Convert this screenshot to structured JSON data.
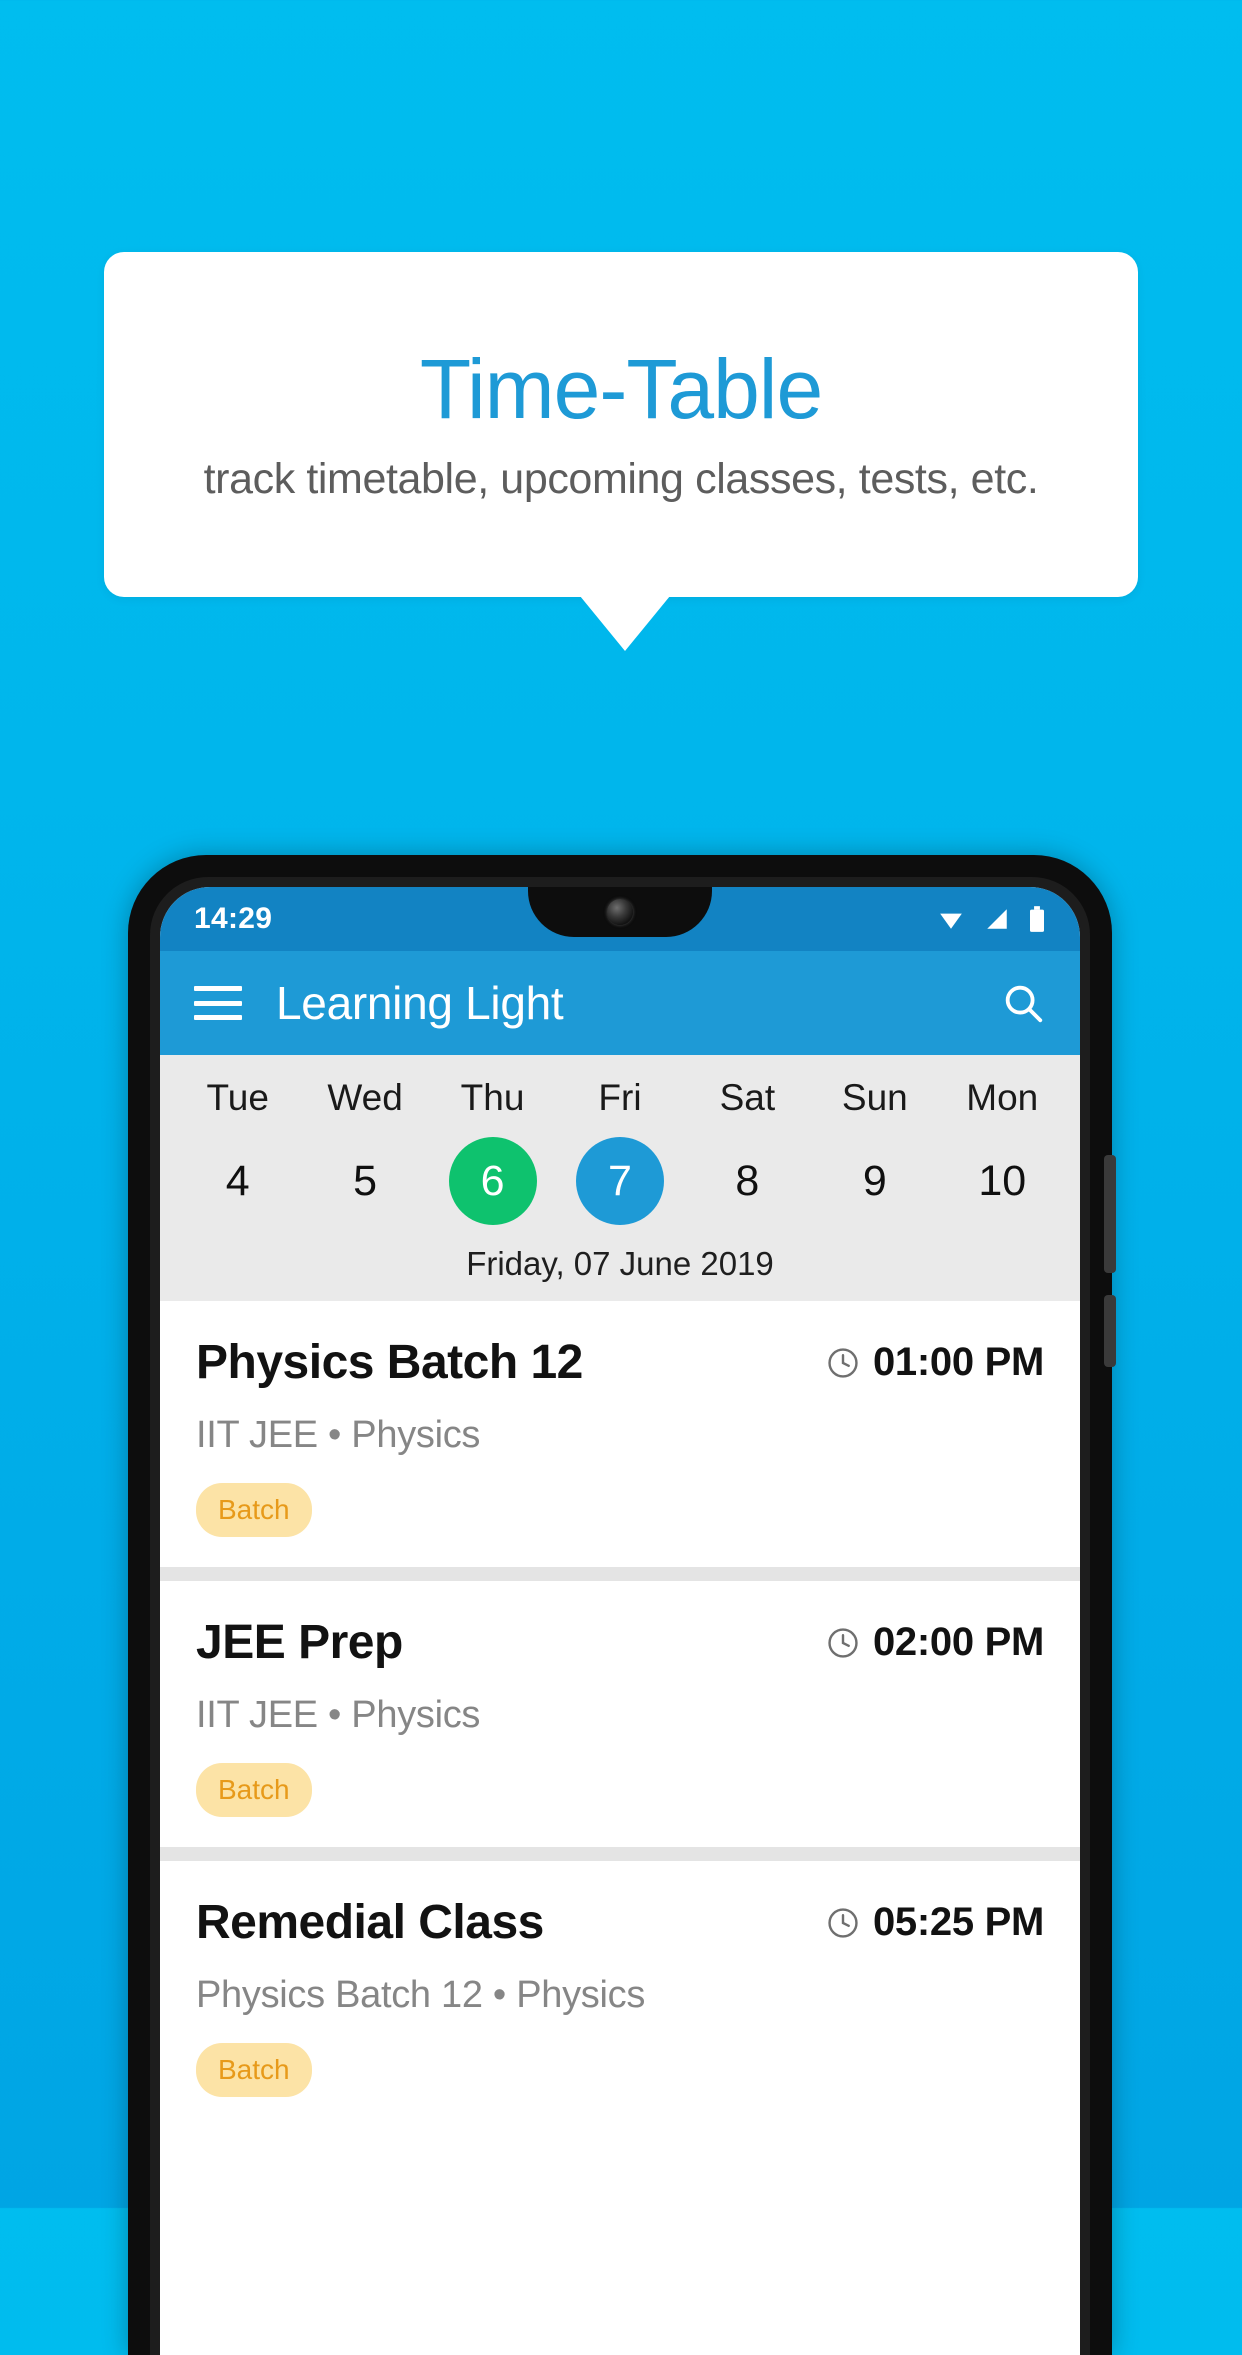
{
  "promo": {
    "title": "Time-Table",
    "subtitle": "track timetable, upcoming classes, tests, etc.",
    "title_color": "#1e9ad6",
    "background_color": "#00b6ec"
  },
  "phone": {
    "status_bar": {
      "time": "14:29",
      "icons": [
        "wifi-icon",
        "signal-icon",
        "battery-icon"
      ]
    },
    "app_bar": {
      "menu_icon": "hamburger-menu-icon",
      "title": "Learning Light",
      "search_icon": "search-icon",
      "background_color": "#1e9ad6"
    },
    "calendar": {
      "days": [
        {
          "dow": "Tue",
          "num": "4",
          "state": "normal"
        },
        {
          "dow": "Wed",
          "num": "5",
          "state": "normal"
        },
        {
          "dow": "Thu",
          "num": "6",
          "state": "today"
        },
        {
          "dow": "Fri",
          "num": "7",
          "state": "selected"
        },
        {
          "dow": "Sat",
          "num": "8",
          "state": "normal"
        },
        {
          "dow": "Sun",
          "num": "9",
          "state": "normal"
        },
        {
          "dow": "Mon",
          "num": "10",
          "state": "normal"
        }
      ],
      "today_color": "#0ec26e",
      "selected_color": "#1e9ad6",
      "full_date": "Friday, 07 June 2019"
    },
    "events": [
      {
        "title": "Physics Batch 12",
        "time": "01:00 PM",
        "subtitle": "IIT JEE • Physics",
        "badge": "Batch"
      },
      {
        "title": "JEE Prep",
        "time": "02:00 PM",
        "subtitle": "IIT JEE • Physics",
        "badge": "Batch"
      },
      {
        "title": "Remedial Class",
        "time": "05:25 PM",
        "subtitle": "Physics Batch 12 • Physics",
        "badge": "Batch"
      }
    ]
  }
}
